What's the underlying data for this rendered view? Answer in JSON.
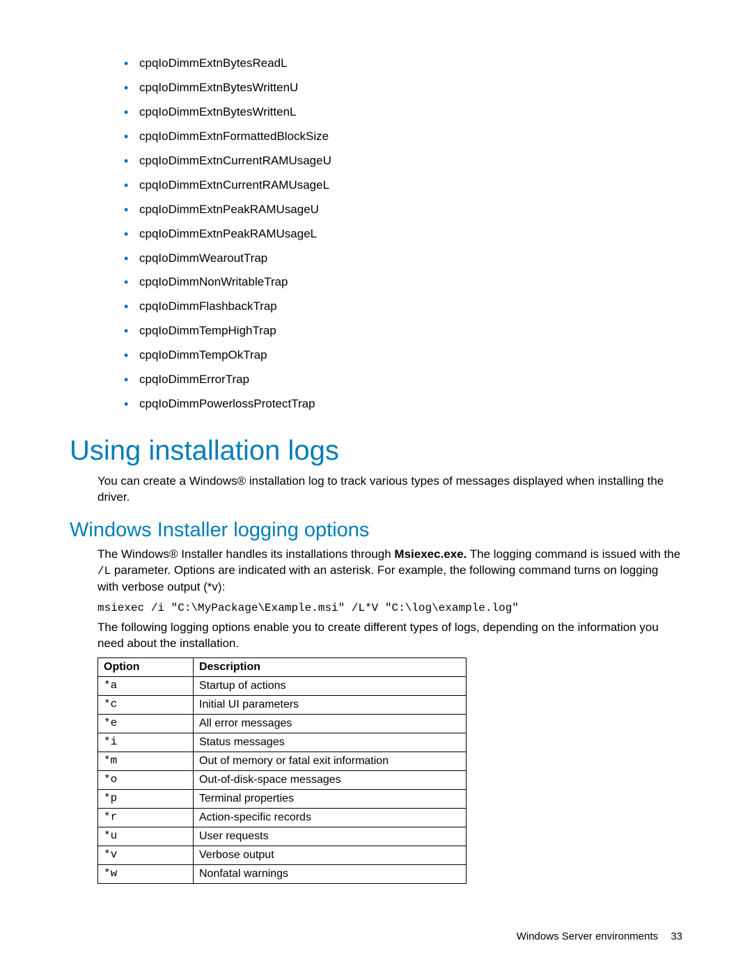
{
  "snmp_items": [
    "cpqIoDimmExtnBytesReadL",
    "cpqIoDimmExtnBytesWrittenU",
    "cpqIoDimmExtnBytesWrittenL",
    "cpqIoDimmExtnFormattedBlockSize",
    "cpqIoDimmExtnCurrentRAMUsageU",
    "cpqIoDimmExtnCurrentRAMUsageL",
    "cpqIoDimmExtnPeakRAMUsageU",
    "cpqIoDimmExtnPeakRAMUsageL",
    "cpqIoDimmWearoutTrap",
    "cpqIoDimmNonWritableTrap",
    "cpqIoDimmFlashbackTrap",
    "cpqIoDimmTempHighTrap",
    "cpqIoDimmTempOkTrap",
    "cpqIoDimmErrorTrap",
    "cpqIoDimmPowerlossProtectTrap"
  ],
  "heading_main": "Using installation logs",
  "para_main": "You can create a Windows® installation log to track various types of messages displayed when installing the driver.",
  "heading_sub": "Windows Installer logging options",
  "para_sub_pre": "The Windows® Installer handles its installations through ",
  "msi_exe": "Msiexec.exe.",
  "para_sub_mid": " The logging command is issued with the ",
  "l_param": "/L",
  "para_sub_post": " parameter. Options are indicated with an asterisk. For example, the following command turns on logging with verbose output (*v):",
  "code_block": "msiexec /i \"C:\\MyPackage\\Example.msi\" /L*V \"C:\\log\\example.log\"",
  "para_after_code": "The following logging options enable you to create different types of logs, depending on the information you need about the installation.",
  "table": {
    "header_option": "Option",
    "header_desc": "Description",
    "rows": [
      {
        "opt": "*a",
        "desc": "Startup of actions"
      },
      {
        "opt": "*c",
        "desc": "Initial UI parameters"
      },
      {
        "opt": "*e",
        "desc": "All error messages"
      },
      {
        "opt": "*i",
        "desc": "Status messages"
      },
      {
        "opt": "*m",
        "desc": "Out of memory or fatal exit information"
      },
      {
        "opt": "*o",
        "desc": "Out-of-disk-space messages"
      },
      {
        "opt": "*p",
        "desc": "Terminal properties"
      },
      {
        "opt": "*r",
        "desc": "Action-specific records"
      },
      {
        "opt": "*u",
        "desc": "User requests"
      },
      {
        "opt": "*v",
        "desc": "Verbose output"
      },
      {
        "opt": "*w",
        "desc": "Nonfatal warnings"
      }
    ]
  },
  "footer_text": "Windows Server environments",
  "footer_page": "33"
}
